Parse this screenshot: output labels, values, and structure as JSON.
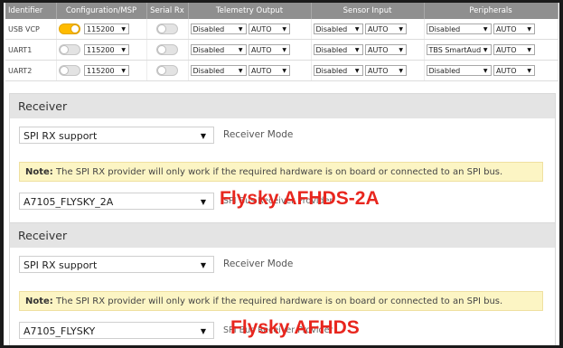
{
  "ports_table": {
    "headers": [
      "Identifier",
      "Configuration/MSP",
      "Serial Rx",
      "Telemetry Output",
      "Sensor Input",
      "Peripherals"
    ],
    "rows": [
      {
        "identifier": "USB VCP",
        "msp_on": true,
        "baud": "115200",
        "serial_rx_on": false,
        "telemetry": "Disabled",
        "telemetry_baud": "AUTO",
        "sensor": "Disabled",
        "sensor_baud": "AUTO",
        "peripheral": "Disabled",
        "peripheral_baud": "AUTO"
      },
      {
        "identifier": "UART1",
        "msp_on": false,
        "baud": "115200",
        "serial_rx_on": false,
        "telemetry": "Disabled",
        "telemetry_baud": "AUTO",
        "sensor": "Disabled",
        "sensor_baud": "AUTO",
        "peripheral": "TBS SmartAud",
        "peripheral_baud": "AUTO"
      },
      {
        "identifier": "UART2",
        "msp_on": false,
        "baud": "115200",
        "serial_rx_on": false,
        "telemetry": "Disabled",
        "telemetry_baud": "AUTO",
        "sensor": "Disabled",
        "sensor_baud": "AUTO",
        "peripheral": "Disabled",
        "peripheral_baud": "AUTO"
      }
    ],
    "colors": {
      "header_bg": "#8f8f8f",
      "toggle_on": "#ffbb00"
    }
  },
  "receiver_top": {
    "title": "Receiver",
    "mode_value": "SPI RX support",
    "mode_label": "Receiver Mode",
    "note_bold": "Note:",
    "note_text": " The SPI RX provider will only work if the required hardware is on board or connected to an SPI bus.",
    "provider_value": "A7105_FLYSKY_2A",
    "provider_label": "SPI Bus Receiver Provider",
    "overlay_text": "Flysky AFHDS-2A"
  },
  "receiver_bottom": {
    "title": "Receiver",
    "mode_value": "SPI RX support",
    "mode_label": "Receiver Mode",
    "note_bold": "Note:",
    "note_text": " The SPI RX provider will only work if the required hardware is on board or connected to an SPI bus.",
    "provider_value": "A7105_FLYSKY",
    "provider_label": "SPI Bus Receiver Provider",
    "overlay_text": "Flysky AFHDS"
  },
  "colors": {
    "overlay": "#e8261e",
    "note_bg": "#fcf5c4"
  }
}
